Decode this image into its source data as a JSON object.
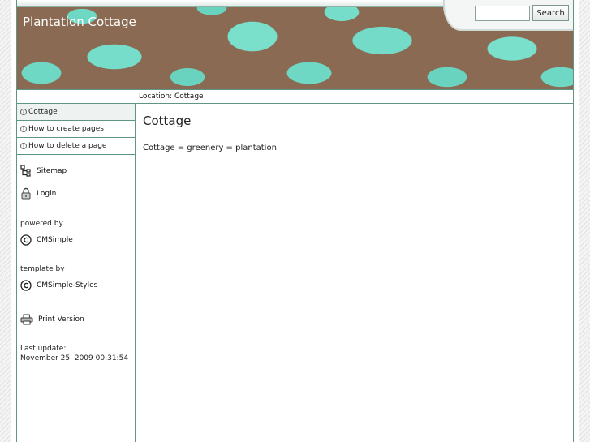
{
  "header": {
    "site_title": "Plantation Cottage",
    "search_placeholder": "",
    "search_button": "Search"
  },
  "location": {
    "text": "Location: Cottage"
  },
  "sidebar": {
    "menu": [
      {
        "label": "Cottage",
        "active": true
      },
      {
        "label": "How to create pages",
        "active": false
      },
      {
        "label": "How to delete a page",
        "active": false
      }
    ],
    "sitemap_label": "Sitemap",
    "login_label": "Login",
    "powered_by_label": "powered by",
    "cmsimple_label": "CMSimple",
    "template_by_label": "template by",
    "cmsimple_styles_label": "CMSimple-Styles",
    "print_label": "Print Version",
    "last_update_label": "Last update:",
    "last_update_value": "November 25. 2009 00:31:54"
  },
  "content": {
    "title": "Cottage",
    "text": "Cottage = greenery = plantation"
  },
  "colors": {
    "accent": "#5f9585",
    "header_brown": "#8a6a52",
    "leaf_teal": "#6fd8c4"
  },
  "icons": [
    "sitemap-icon",
    "lock-icon",
    "copyright-icon",
    "printer-icon",
    "arrow-circle-icon"
  ]
}
